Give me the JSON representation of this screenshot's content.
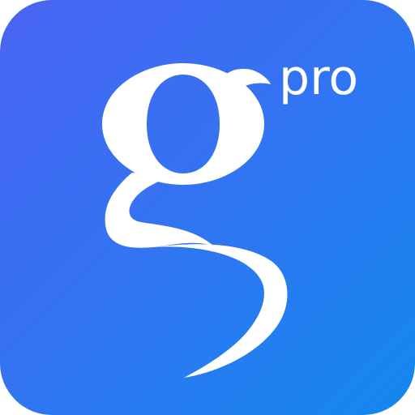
{
  "app_icon": {
    "suffix_label": "pro",
    "glyph_icon": "letter-g-icon",
    "colors": {
      "gradient_start": "#4a64f2",
      "gradient_mid": "#3473f2",
      "gradient_end": "#1388ef",
      "glyph": "#ffffff"
    }
  }
}
